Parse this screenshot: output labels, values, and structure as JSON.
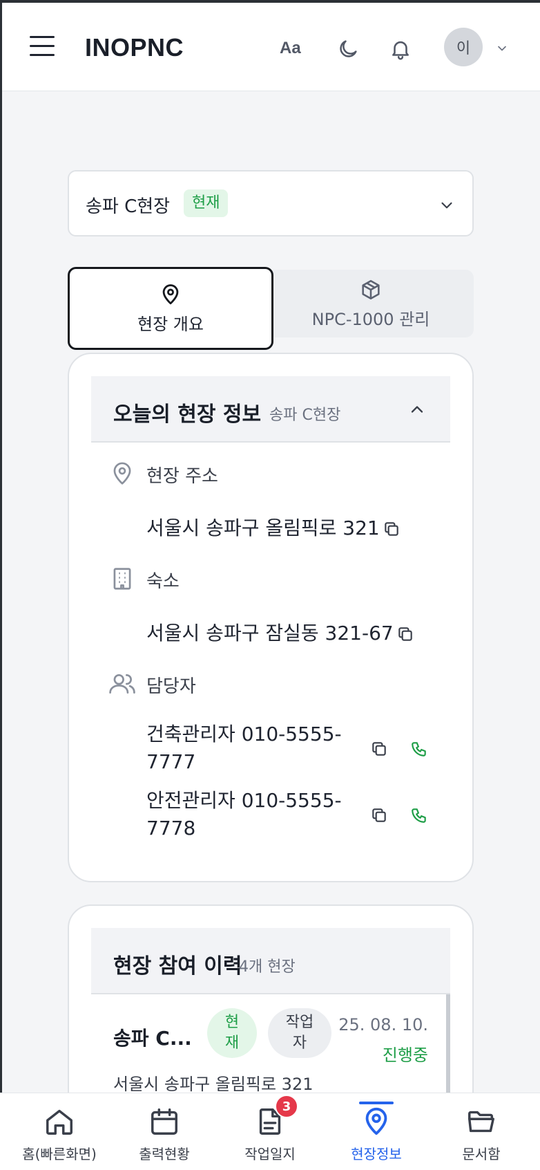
{
  "header": {
    "logo": "INOPNC",
    "font_size_label": "Aa",
    "avatar_initial": "이"
  },
  "site_select": {
    "name": "송파 C현장",
    "badge": "현재"
  },
  "tabs": [
    {
      "label": "현장 개요",
      "icon": "map-pin-icon",
      "active": true
    },
    {
      "label": "NPC-1000 관리",
      "icon": "package-icon",
      "active": false
    }
  ],
  "today_info": {
    "title": "오늘의 현장 정보",
    "subtitle": "송파 C현장",
    "address_label": "현장 주소",
    "address_value": "서울시 송파구 올림픽로 321",
    "lodging_label": "숙소",
    "lodging_value": "서울시 송파구 잠실동 321-67",
    "manager_label": "담당자",
    "managers": [
      {
        "line1": "건축관리자 010-5555-",
        "line2": "7777"
      },
      {
        "line1": "안전관리자 010-5555-",
        "line2": "7778"
      }
    ]
  },
  "history": {
    "title": "현장 참여 이력",
    "count": "4개 현장",
    "items": [
      {
        "name": "송파 C...",
        "badge_current_1": "현",
        "badge_current_2": "재",
        "badge_role_1": "작업",
        "badge_role_2": "자",
        "date": "25. 08. 10.",
        "status": "진행중",
        "address": "서울시 송파구 올림픽로 321"
      }
    ]
  },
  "bottom_nav": {
    "items": [
      {
        "label": "홈(빠른화면)",
        "icon": "home-icon"
      },
      {
        "label": "출력현황",
        "icon": "calendar-icon"
      },
      {
        "label": "작업일지",
        "icon": "document-icon",
        "badge": "3"
      },
      {
        "label": "현장정보",
        "icon": "map-pin-icon",
        "active": true
      },
      {
        "label": "문서함",
        "icon": "folder-icon"
      }
    ]
  },
  "colors": {
    "accent_green": "#1e9e47",
    "accent_blue": "#2563eb",
    "badge_red": "#e5384a"
  }
}
